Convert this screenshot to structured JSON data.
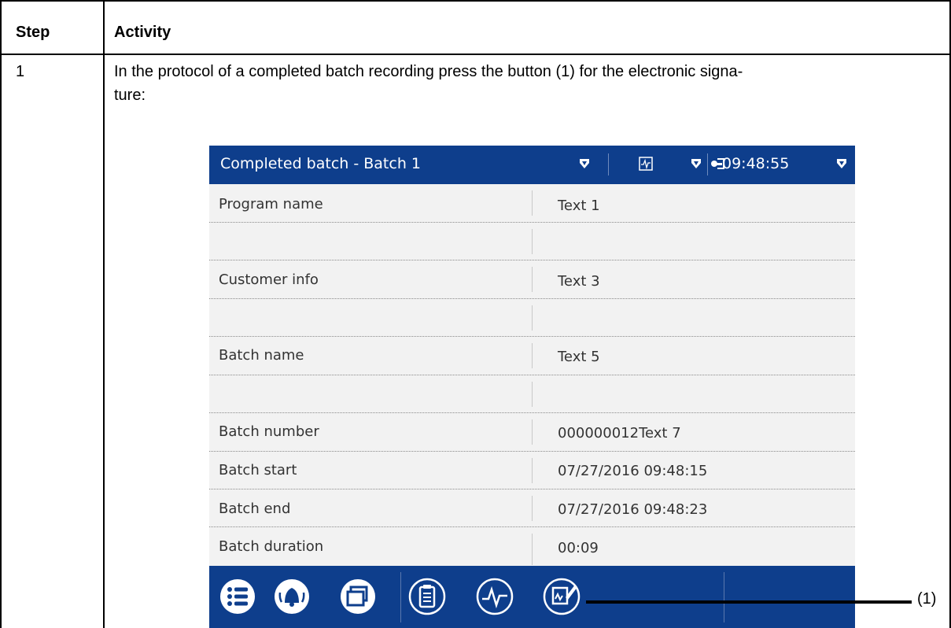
{
  "table": {
    "headers": {
      "step": "Step",
      "activity": "Activity"
    },
    "rows": [
      {
        "step": "1",
        "activity_line1": "In the protocol of a completed batch recording press the button (1) for the electronic signa-",
        "activity_line2": "ture:"
      }
    ]
  },
  "device": {
    "title": "Completed batch - Batch 1",
    "clock": "09:48:55",
    "fields": [
      {
        "label": "Program name",
        "value": "Text 1"
      },
      {
        "label": "",
        "value": ""
      },
      {
        "label": "Customer info",
        "value": "Text 3"
      },
      {
        "label": "",
        "value": ""
      },
      {
        "label": "Batch name",
        "value": "Text 5"
      },
      {
        "label": "",
        "value": ""
      },
      {
        "label": "Batch number",
        "value": "000000012Text 7"
      },
      {
        "label": "Batch start",
        "value": "07/27/2016 09:48:15"
      },
      {
        "label": "Batch end",
        "value": "07/27/2016 09:48:23"
      },
      {
        "label": "Batch duration",
        "value": "00:09"
      }
    ],
    "bottom_buttons": [
      "menu-icon",
      "alarm-bell-icon",
      "windows-icon",
      "protocol-clipboard-icon",
      "signal-curve-icon",
      "electronic-signature-icon"
    ],
    "colors": {
      "bar": "#0e3e8c",
      "background": "#f2f2f2"
    }
  },
  "callout": {
    "label": "(1)"
  }
}
